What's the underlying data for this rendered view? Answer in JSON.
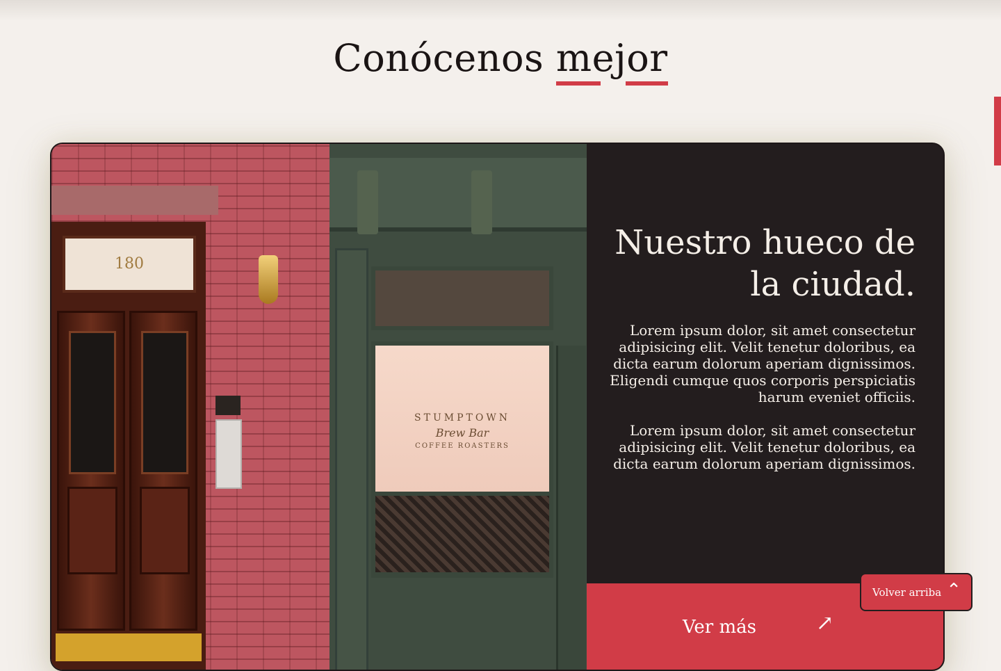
{
  "section": {
    "title_start": "Conócenos ",
    "title_accent": "mejor"
  },
  "photo": {
    "address_number": "180",
    "sign_line1": "STUMPTOWN",
    "sign_line2": "Brew Bar",
    "sign_line3": "COFFEE ROASTERS"
  },
  "about": {
    "heading": "Nuestro hueco de la ciudad.",
    "paragraph1": "Lorem ipsum dolor, sit amet consectetur adipisicing elit. Velit tenetur doloribus, ea dicta earum dolorum aperiam dignissimos. Eligendi cumque quos corporis perspiciatis harum eveniet officiis.",
    "paragraph2": "Lorem ipsum dolor, sit amet consectetur adipisicing elit. Velit tenetur doloribus, ea dicta earum dolorum aperiam dignissimos.",
    "cta_label": "Ver más",
    "cta_icon": "arrow-up-right-icon"
  },
  "back_to_top": {
    "label": "Volver arriba",
    "icon": "chevron-up-icon"
  },
  "colors": {
    "background": "#f4f0ec",
    "accent": "#d13c47",
    "dark_panel": "#231d1e",
    "text_light": "#f5efe8"
  }
}
